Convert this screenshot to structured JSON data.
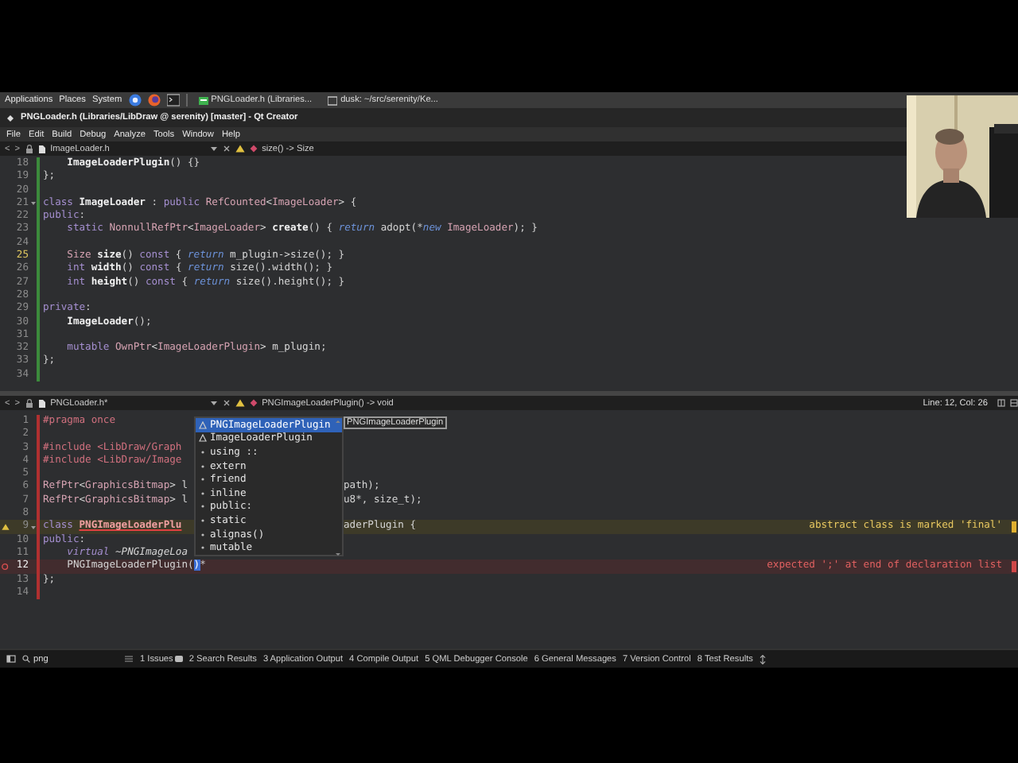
{
  "taskbar": {
    "menus": [
      "Applications",
      "Places",
      "System"
    ],
    "launchers": [
      {
        "kind": "chrome"
      },
      {
        "kind": "firefox"
      },
      {
        "kind": "terminal"
      }
    ],
    "tasks": [
      {
        "label": "PNGLoader.h (Libraries...",
        "kind": "editor"
      },
      {
        "label": "dusk: ~/src/serenity/Ke...",
        "kind": "terminal"
      }
    ]
  },
  "window": {
    "title": "PNGLoader.h (Libraries/LibDraw @ serenity) [master] - Qt Creator"
  },
  "menu": [
    "File",
    "Edit",
    "Build",
    "Debug",
    "Analyze",
    "Tools",
    "Window",
    "Help"
  ],
  "editors": [
    {
      "toolbar": {
        "nav": [
          "<",
          ">"
        ],
        "file": "ImageLoader.h",
        "function": "size() -> Size",
        "warning": true
      },
      "kind": "added",
      "lines": [
        {
          "number": "18",
          "current": false,
          "tokens": [
            {
              "text": "    ImageLoaderPlugin",
              "kind": "decl"
            },
            {
              "text": "() {}"
            }
          ]
        },
        {
          "number": "19",
          "current": false,
          "tokens": [
            {
              "text": "};"
            }
          ]
        },
        {
          "number": "20",
          "current": false
        },
        {
          "number": "21",
          "current": false,
          "fold": true,
          "tokens": [
            {
              "text": "class ",
              "kind": "keyword"
            },
            {
              "text": "ImageLoader",
              "kind": "decl"
            },
            {
              "text": " : "
            },
            {
              "text": "public ",
              "kind": "keyword"
            },
            {
              "text": "RefCounted",
              "kind": "type"
            },
            {
              "text": "<"
            },
            {
              "text": "ImageLoader",
              "kind": "type"
            },
            {
              "text": "> {"
            }
          ]
        },
        {
          "number": "22",
          "current": false,
          "tokens": [
            {
              "text": "public",
              "kind": "keyword"
            },
            {
              "text": ":"
            }
          ]
        },
        {
          "number": "23",
          "current": false,
          "tokens": [
            {
              "text": "    static ",
              "kind": "keyword"
            },
            {
              "text": "NonnullRefPtr",
              "kind": "type"
            },
            {
              "text": "<"
            },
            {
              "text": "ImageLoader",
              "kind": "type"
            },
            {
              "text": "> "
            },
            {
              "text": "create",
              "kind": "decl"
            },
            {
              "text": "() { "
            },
            {
              "text": "return",
              "kind": "flow"
            },
            {
              "text": " adopt(*"
            },
            {
              "text": "new ",
              "kind": "flow"
            },
            {
              "text": "ImageLoader",
              "kind": "type"
            },
            {
              "text": "); }"
            }
          ]
        },
        {
          "number": "24",
          "current": false
        },
        {
          "number": "25",
          "current": true,
          "tokens": [
            {
              "text": "    Size ",
              "kind": "type"
            },
            {
              "text": "size",
              "kind": "decl"
            },
            {
              "text": "() "
            },
            {
              "text": "const",
              "kind": "keyword"
            },
            {
              "text": " { "
            },
            {
              "text": "return",
              "kind": "flow"
            },
            {
              "text": " m_plugin",
              "kind": "member"
            },
            {
              "text": "->size(); }"
            }
          ]
        },
        {
          "number": "26",
          "current": false,
          "tokens": [
            {
              "text": "    int ",
              "kind": "keyword"
            },
            {
              "text": "width",
              "kind": "decl"
            },
            {
              "text": "() "
            },
            {
              "text": "const",
              "kind": "keyword"
            },
            {
              "text": " { "
            },
            {
              "text": "return",
              "kind": "flow"
            },
            {
              "text": " size().width(); }"
            }
          ]
        },
        {
          "number": "27",
          "current": false,
          "tokens": [
            {
              "text": "    int ",
              "kind": "keyword"
            },
            {
              "text": "height",
              "kind": "decl"
            },
            {
              "text": "() "
            },
            {
              "text": "const",
              "kind": "keyword"
            },
            {
              "text": " { "
            },
            {
              "text": "return",
              "kind": "flow"
            },
            {
              "text": " size().height(); }"
            }
          ]
        },
        {
          "number": "28",
          "current": false
        },
        {
          "number": "29",
          "current": false,
          "tokens": [
            {
              "text": "private",
              "kind": "keyword"
            },
            {
              "text": ":"
            }
          ]
        },
        {
          "number": "30",
          "current": false,
          "tokens": [
            {
              "text": "    ImageLoader",
              "kind": "decl"
            },
            {
              "text": "();"
            }
          ]
        },
        {
          "number": "31",
          "current": false
        },
        {
          "number": "32",
          "current": false,
          "tokens": [
            {
              "text": "    mutable ",
              "kind": "keyword"
            },
            {
              "text": "OwnPtr",
              "kind": "type"
            },
            {
              "text": "<"
            },
            {
              "text": "ImageLoaderPlugin",
              "kind": "type"
            },
            {
              "text": "> "
            },
            {
              "text": "m_plugin",
              "kind": "member"
            },
            {
              "text": ";"
            }
          ]
        },
        {
          "number": "33",
          "current": false,
          "tokens": [
            {
              "text": "};"
            }
          ]
        },
        {
          "number": "34",
          "current": false
        }
      ]
    },
    {
      "toolbar": {
        "nav": [
          "<",
          ">"
        ],
        "file": "PNGLoader.h*",
        "function": "PNGImageLoaderPlugin() -> void",
        "warning": true,
        "position": "Line: 12, Col: 26"
      },
      "kind": "modified",
      "lines": [
        {
          "number": "1",
          "current": false,
          "tokens": [
            {
              "text": "#pragma once",
              "kind": "preproc"
            }
          ]
        },
        {
          "number": "2",
          "current": false
        },
        {
          "number": "3",
          "current": false,
          "tokens": [
            {
              "text": "#include <LibDraw/Graph",
              "kind": "preproc"
            }
          ]
        },
        {
          "number": "4",
          "current": false,
          "tokens": [
            {
              "text": "#include <LibDraw/Image",
              "kind": "preproc"
            }
          ]
        },
        {
          "number": "5",
          "current": false
        },
        {
          "number": "6",
          "current": false,
          "tokens": [
            {
              "text": "RefPtr",
              "kind": "type"
            },
            {
              "text": "<"
            },
            {
              "text": "GraphicsBitmap",
              "kind": "type"
            },
            {
              "text": "> l"
            }
          ],
          "right": [
            {
              "text": "path);"
            }
          ]
        },
        {
          "number": "7",
          "current": false,
          "tokens": [
            {
              "text": "RefPtr",
              "kind": "type"
            },
            {
              "text": "<"
            },
            {
              "text": "GraphicsBitmap",
              "kind": "type"
            },
            {
              "text": "> l"
            }
          ],
          "right": [
            {
              "text": "u8*, size_t);"
            }
          ]
        },
        {
          "number": "8",
          "current": false
        },
        {
          "number": "9",
          "current": false,
          "fold": true,
          "tokens": [
            {
              "text": "class ",
              "kind": "keyword"
            },
            {
              "text": "PNGImageLoaderPlu",
              "kind": "error"
            }
          ],
          "right": [
            {
              "text": "aderPlugin {"
            }
          ],
          "annotation": {
            "kind": "warning",
            "text": "abstract class is marked 'final'"
          }
        },
        {
          "number": "10",
          "current": false,
          "tokens": [
            {
              "text": "public",
              "kind": "keyword"
            },
            {
              "text": ":"
            }
          ]
        },
        {
          "number": "11",
          "current": false,
          "tokens": [
            {
              "text": "    virtual ",
              "kind": "virtual"
            },
            {
              "text": "~PNGImageLoa",
              "kind": "italic"
            }
          ]
        },
        {
          "number": "12",
          "current": true,
          "tokens": [
            {
              "text": "    PNGImageLoaderPlugin("
            },
            {
              "text": ")",
              "kind": "cursor"
            },
            {
              "text": "*"
            }
          ],
          "annotation": {
            "kind": "error",
            "text": "expected ';' at end of declaration list"
          }
        },
        {
          "number": "13",
          "current": false,
          "tokens": [
            {
              "text": "};"
            }
          ]
        },
        {
          "number": "14",
          "current": false
        }
      ],
      "completion": {
        "items": [
          {
            "label": "PNGImageLoaderPlugin",
            "kind": "class",
            "selected": true
          },
          {
            "label": "ImageLoaderPlugin",
            "kind": "class",
            "selected": false
          },
          {
            "label": "using ::",
            "kind": "keyword",
            "selected": false
          },
          {
            "label": "extern",
            "kind": "keyword",
            "selected": false
          },
          {
            "label": "friend",
            "kind": "keyword",
            "selected": false
          },
          {
            "label": "inline",
            "kind": "keyword",
            "selected": false
          },
          {
            "label": "public:",
            "kind": "keyword",
            "selected": false
          },
          {
            "label": "static",
            "kind": "keyword",
            "selected": false
          },
          {
            "label": "alignas()",
            "kind": "keyword",
            "selected": false
          },
          {
            "label": "mutable",
            "kind": "keyword",
            "selected": false
          }
        ],
        "tooltip": "PNGImageLoaderPlugin"
      }
    }
  ],
  "output_bar": {
    "locator": {
      "value": "png"
    },
    "tabs": [
      {
        "label": "1 Issues",
        "badge": true
      },
      {
        "label": "2 Search Results",
        "badge": false
      },
      {
        "label": "3 Application Output",
        "badge": false
      },
      {
        "label": "4 Compile Output",
        "badge": false
      },
      {
        "label": "5 QML Debugger Console",
        "badge": false
      },
      {
        "label": "6 General Messages",
        "badge": false
      },
      {
        "label": "7 Version Control",
        "badge": false
      },
      {
        "label": "8 Test Results",
        "badge": false
      }
    ]
  }
}
